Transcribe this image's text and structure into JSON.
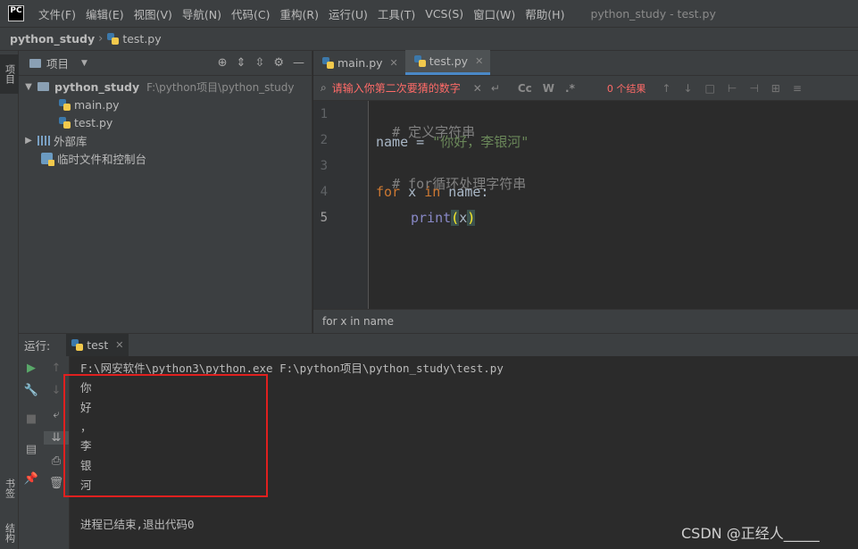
{
  "menubar": {
    "logo": "PC",
    "items": [
      "文件(F)",
      "编辑(E)",
      "视图(V)",
      "导航(N)",
      "代码(C)",
      "重构(R)",
      "运行(U)",
      "工具(T)",
      "VCS(S)",
      "窗口(W)",
      "帮助(H)"
    ],
    "window_title": "python_study - test.py"
  },
  "navbar": {
    "project": "python_study",
    "file": "test.py"
  },
  "left_strip": {
    "project_tab": "项目",
    "bookmarks_tab": "书签",
    "structure_tab": "结构"
  },
  "project_panel": {
    "title": "项目",
    "tree": {
      "root_name": "python_study",
      "root_path": "F:\\python项目\\python_study",
      "files": [
        "main.py",
        "test.py"
      ],
      "external_libs": "外部库",
      "scratches": "临时文件和控制台"
    }
  },
  "editor": {
    "tabs": [
      "main.py",
      "test.py"
    ],
    "active_tab": "test.py",
    "find": {
      "placeholder": "请输入你第二次要猜的数字",
      "opt_case": "Cc",
      "opt_word": "W",
      "opt_regex": ".*",
      "results": "0 个结果"
    },
    "line_numbers": [
      "1",
      "2",
      "3",
      "4",
      "5"
    ],
    "code": {
      "l1": "# 定义字符串",
      "l2_a": "name = ",
      "l2_b": "\"你好，李银河\"",
      "l3": "# for循环处理字符串",
      "l4_kw1": "for",
      "l4_a": " x ",
      "l4_kw2": "in",
      "l4_b": " name:",
      "l5_fn": "print",
      "l5_po": "(",
      "l5_arg": "x",
      "l5_pc": ")"
    },
    "breadcrumb": "for x in name"
  },
  "run": {
    "label": "运行:",
    "tab": "test",
    "command": "F:\\网安软件\\python3\\python.exe F:\\python项目\\python_study\\test.py",
    "output": [
      "你",
      "好",
      "，",
      "李",
      "银",
      "河"
    ],
    "exit_message": "进程已结束,退出代码0"
  },
  "watermark": "CSDN @正经人_____",
  "colors": {
    "accent": "#4a88c7",
    "highlight_box": "#e0201f",
    "find_error": "#ff6b68"
  }
}
